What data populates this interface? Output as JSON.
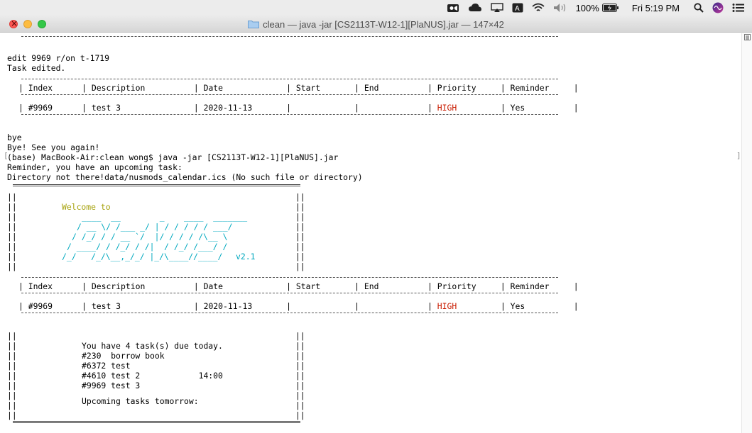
{
  "menubar": {
    "battery": "100%",
    "clock": "Fri 5:19 PM"
  },
  "window": {
    "title": "clean — java -jar [CS2113T-W12-1][PlaNUS].jar — 147×42"
  },
  "terminal": {
    "lines": {
      "l1": "edit 9969 r/on t-1719",
      "l2": "Task edited.",
      "table_header": "| Index      | Description          | Date             | Start       | End          | Priority     | Reminder     |",
      "row1_pre": "| #9969      | test 3               | 2020-11-13       |             |              | ",
      "row1_priority": "HIGH",
      "row1_post": "         | Yes          |",
      "bye": "bye",
      "bye_msg": "Bye! See you again!",
      "prompt": "(base) MacBook-Air:clean wong$ java -jar [CS2113T-W12-1][PlaNUS].jar",
      "reminder": "Reminder, you have an upcoming task:",
      "dir_error": "Directory not there!data/nusmods_calendar.ics (No such file or directory)",
      "box_left": "||",
      "box_right": "||",
      "welcome": "Welcome to",
      "logo1": "____  __        _    ____  _______",
      "logo2": "/ __ \\/ /___ _/ | / / / / / ___/",
      "logo3": "/ /_/ / / __ `/  |/ / / / /\\__ \\",
      "logo4": "/ ____/ / /_/ / /|  / /_/ /___/ /",
      "logo5": "/_/   /_/\\__,_/_/ |_/\\____//____/",
      "version": "v2.1",
      "due_today": "You have 4 task(s) due today.",
      "task1": "#230  borrow book",
      "task2": "#6372 test",
      "task3": "#4610 test 2            14:00",
      "task4": "#9969 test 3",
      "tomorrow": "Upcoming tasks tomorrow:",
      "bracket_l": "[",
      "bracket_r": "]"
    }
  },
  "colors": {
    "priority_high": "#c91b00",
    "welcome": "#a6a20c",
    "logo": "#00a8bf"
  }
}
